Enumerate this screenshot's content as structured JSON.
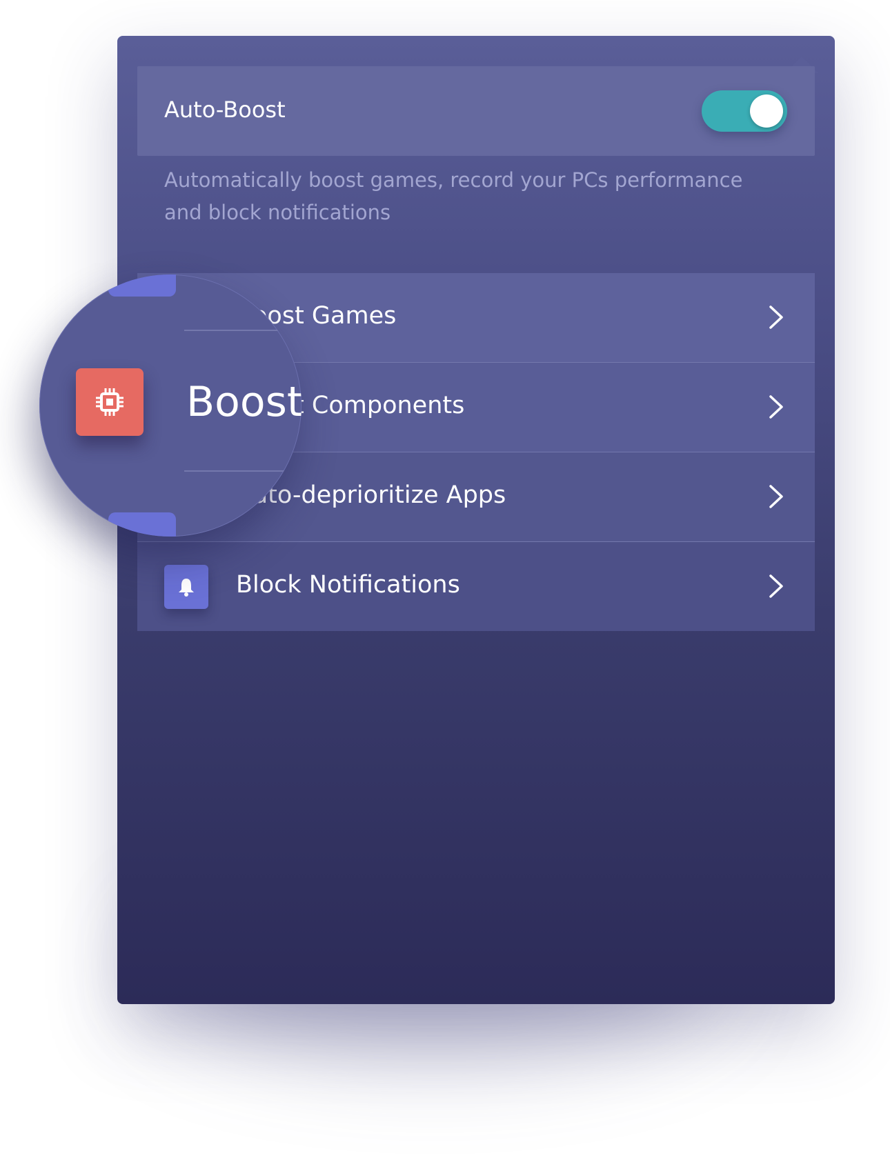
{
  "auto_boost": {
    "label": "Auto-Boost",
    "enabled": true,
    "description": "Automatically boost games, record your PCs performance and block notifications"
  },
  "menu": {
    "items": [
      {
        "label": "Boost Games",
        "icon": "gamepad-icon"
      },
      {
        "label": "Boost Components",
        "icon": "cpu-chip-icon"
      },
      {
        "label": "Auto-deprioritize Apps",
        "icon": "apps-icon"
      },
      {
        "label": "Block Notifications",
        "icon": "bell-icon"
      }
    ]
  },
  "magnifier": {
    "label": "Boost",
    "icon": "cpu-chip-icon"
  },
  "colors": {
    "toggle_on": "#3aadb5",
    "icon_accent": "#6a71d6",
    "highlight_icon": "#e66a62",
    "panel_top": "#5a5e98",
    "panel_bottom": "#2c2b58"
  }
}
